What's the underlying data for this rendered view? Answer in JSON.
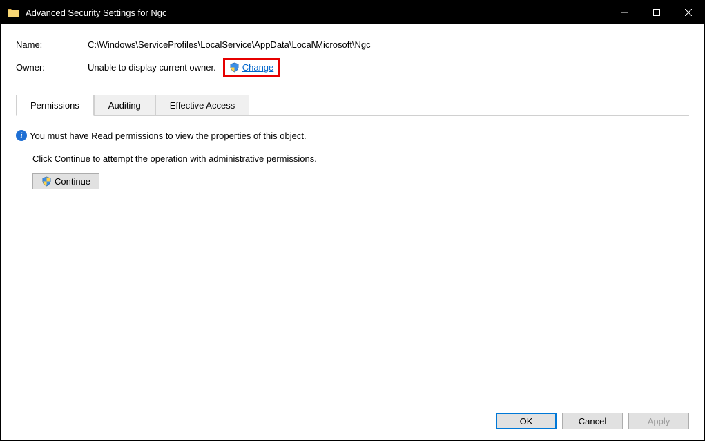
{
  "titlebar": {
    "title": "Advanced Security Settings for Ngc"
  },
  "fields": {
    "name_label": "Name:",
    "name_value": "C:\\Windows\\ServiceProfiles\\LocalService\\AppData\\Local\\Microsoft\\Ngc",
    "owner_label": "Owner:",
    "owner_value": "Unable to display current owner.",
    "change_link": "Change"
  },
  "tabs": {
    "permissions": "Permissions",
    "auditing": "Auditing",
    "effective_access": "Effective Access"
  },
  "body": {
    "info_text": "You must have Read permissions to view the properties of this object.",
    "instruct_text": "Click Continue to attempt the operation with administrative permissions.",
    "continue_label": "Continue"
  },
  "footer": {
    "ok": "OK",
    "cancel": "Cancel",
    "apply": "Apply"
  }
}
